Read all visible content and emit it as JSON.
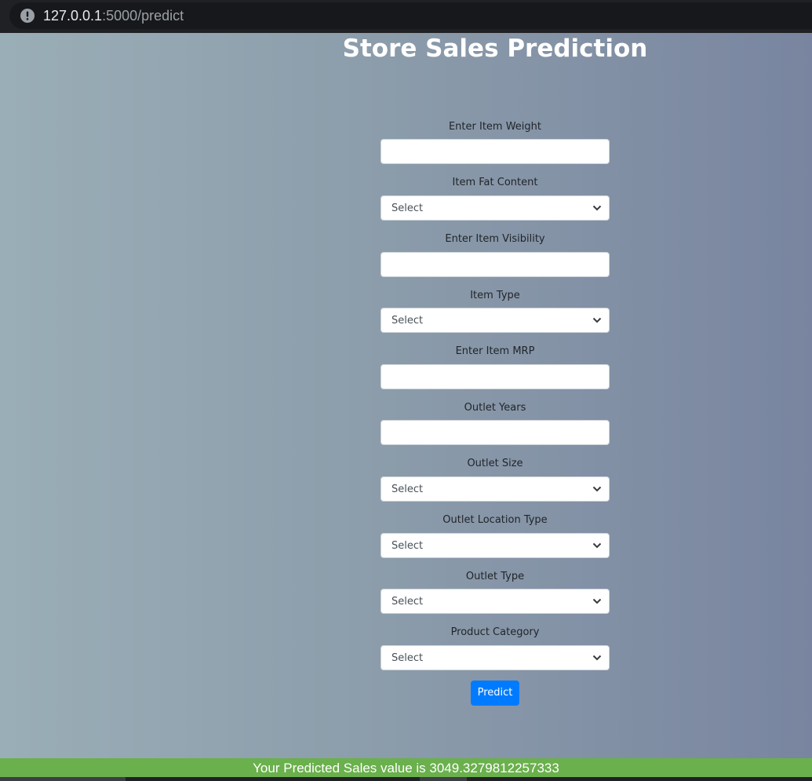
{
  "browser": {
    "url_host": "127.0.0.1",
    "url_rest": ":5000/predict",
    "icon": "info-icon"
  },
  "page": {
    "title": "Store Sales Prediction"
  },
  "form": {
    "item_weight": {
      "label": "Enter Item Weight",
      "value": ""
    },
    "fat_content": {
      "label": "Item Fat Content",
      "selected": "Select"
    },
    "item_visibility": {
      "label": "Enter Item Visibility",
      "value": ""
    },
    "item_type": {
      "label": "Item Type",
      "selected": "Select"
    },
    "item_mrp": {
      "label": "Enter Item MRP",
      "value": ""
    },
    "outlet_years": {
      "label": "Outlet Years",
      "value": ""
    },
    "outlet_size": {
      "label": "Outlet Size",
      "selected": "Select"
    },
    "outlet_location_type": {
      "label": "Outlet Location Type",
      "selected": "Select"
    },
    "outlet_type": {
      "label": "Outlet Type",
      "selected": "Select"
    },
    "product_category": {
      "label": "Product Category",
      "selected": "Select"
    },
    "predict_label": "Predict"
  },
  "result": {
    "text": "Your Predicted Sales value is 3049.3279812257333"
  },
  "colors": {
    "accent": "#007bff",
    "result_bg": "#6ab04c"
  }
}
